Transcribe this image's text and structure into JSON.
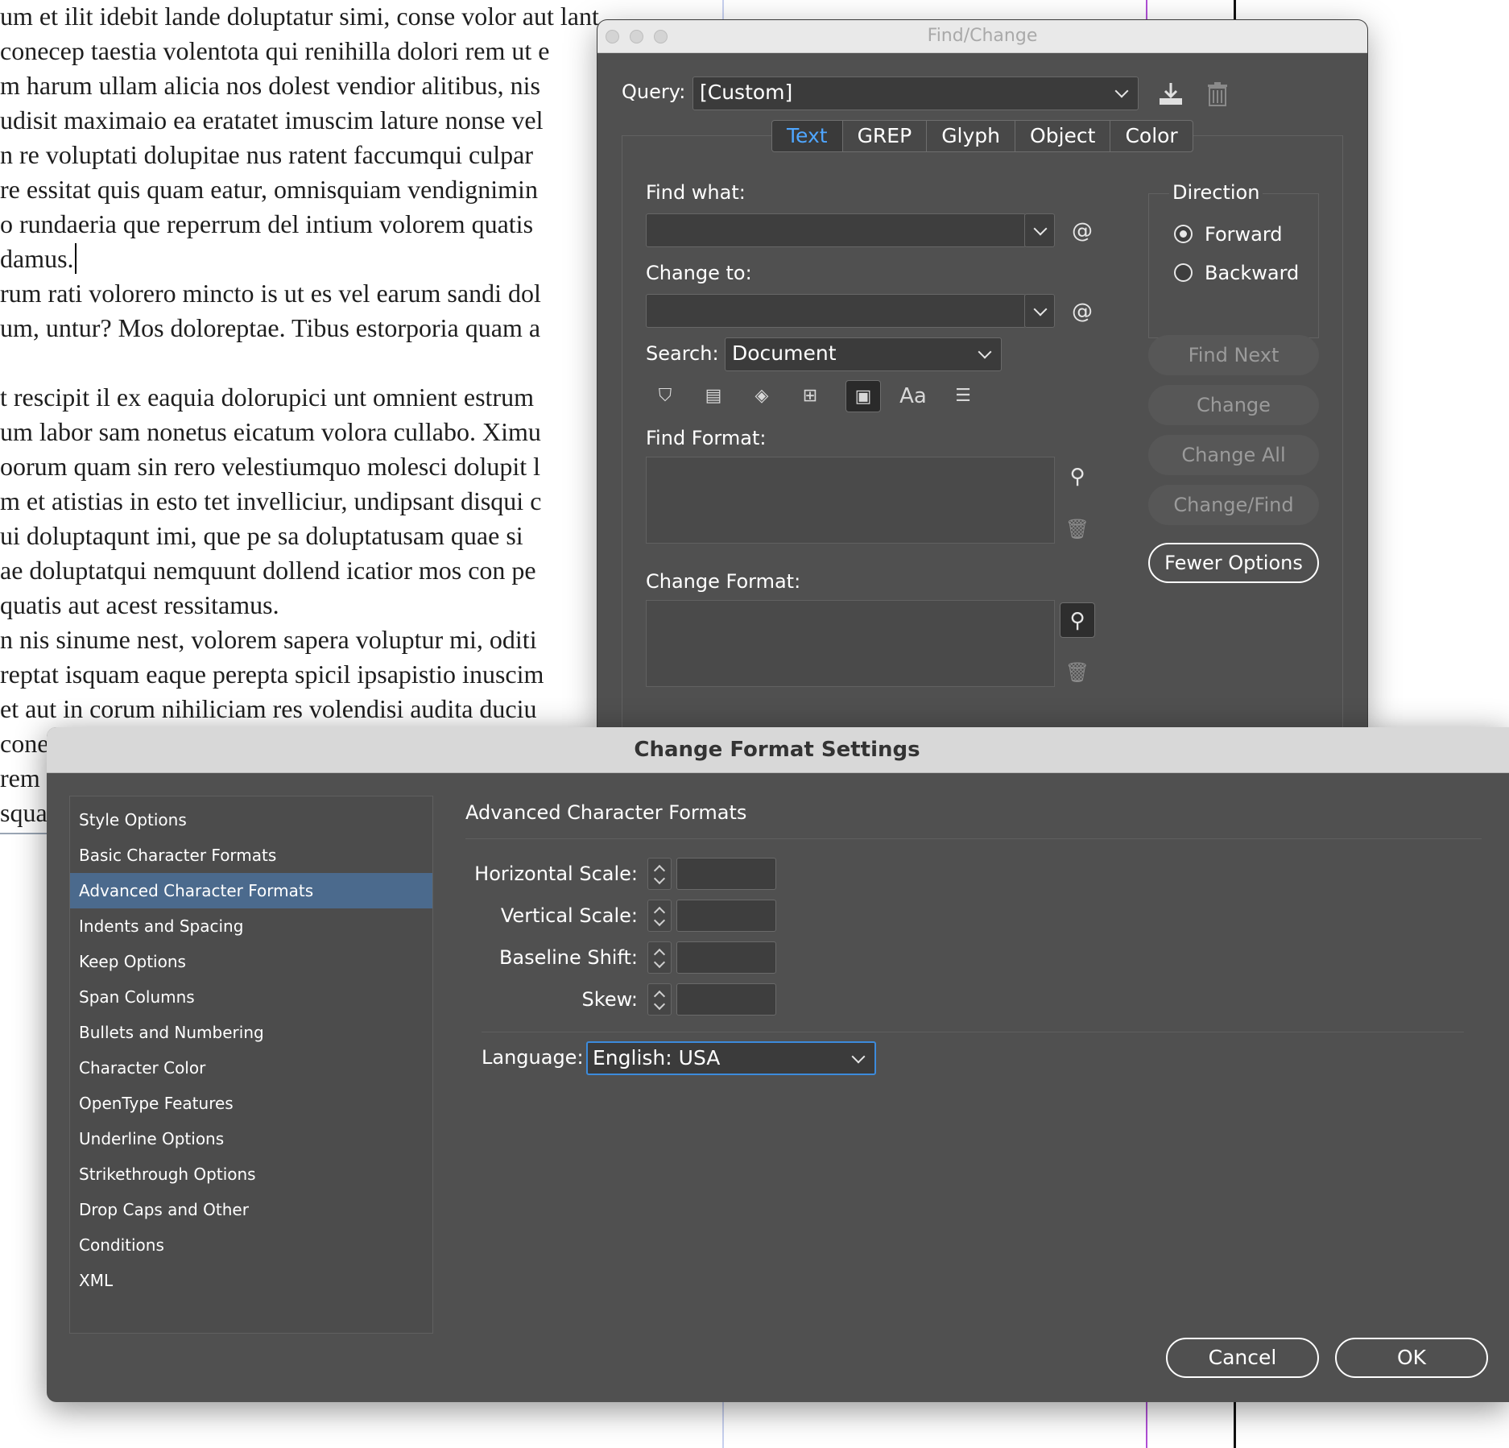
{
  "document": {
    "lines": [
      "um et ilit idebit lande doluptatur simi, conse volor aut lant",
      "conecep taestia volentota qui renihilla dolori rem ut e",
      "m harum ullam alicia nos dolest vendior alitibus, nis",
      "udisit maximaio ea eratatet imuscim lature nonse vel",
      "n re voluptati dolupitae nus ratent faccumqui culpar",
      "re essitat quis quam eatur, omnisquiam vendignimin",
      "o rundaeria que reperrum del intium volorem quatis",
      "damus.",
      "rum rati volorero mincto is ut es vel earum sandi dol",
      "um, untur? Mos doloreptae. Tibus estorporia quam a",
      "",
      "t rescipit il ex eaquia dolorupici unt omnient estrum",
      "um labor sam nonetus eicatum volora cullabo. Ximu",
      "oorum quam sin rero velestiumquo molesci dolupit l",
      "m et atistias in esto tet invelliciur, undipsant disqui c",
      "ui doluptaqunt imi, que pe sa doluptatusam quae si",
      "ae doluptatqui nemquunt dollend icatior mos con pe",
      "quatis aut acest ressitamus.",
      "n nis sinume nest, volorem sapera voluptur mi, oditi",
      "reptat isquam eaque perepta spicil ipsapistio inuscim",
      "et aut in corum nihiliciam res volendisi audita duciu",
      "cone",
      "rem",
      "squa"
    ],
    "guide_colors": {
      "magenta": "#b04fd6",
      "black": "#111111",
      "blue": "#a9b7e6"
    }
  },
  "find_change": {
    "title": "Find/Change",
    "query_label": "Query:",
    "query_value": "[Custom]",
    "save_query_icon": "download-icon",
    "delete_query_icon": "trash-icon",
    "tabs": [
      {
        "label": "Text",
        "active": true
      },
      {
        "label": "GREP",
        "active": false
      },
      {
        "label": "Glyph",
        "active": false
      },
      {
        "label": "Object",
        "active": false
      },
      {
        "label": "Color",
        "active": false
      }
    ],
    "find_what_label": "Find what:",
    "find_what_value": "",
    "change_to_label": "Change to:",
    "change_to_value": "",
    "special_char_glyph": "@",
    "search_label": "Search:",
    "search_value": "Document",
    "option_icons": [
      {
        "name": "include-locked-layers-icon",
        "glyph": "⛉"
      },
      {
        "name": "include-locked-stories-icon",
        "glyph": "▤"
      },
      {
        "name": "include-hidden-layers-icon",
        "glyph": "◈"
      },
      {
        "name": "include-master-pages-icon",
        "glyph": "⊞"
      },
      {
        "name": "include-footnotes-icon",
        "glyph": "▣"
      },
      {
        "name": "case-sensitive-icon",
        "glyph": "Aa"
      },
      {
        "name": "whole-word-icon",
        "glyph": "☰"
      }
    ],
    "find_format_label": "Find Format:",
    "change_format_label": "Change Format:",
    "direction": {
      "legend": "Direction",
      "forward": "Forward",
      "backward": "Backward",
      "selected": "forward"
    },
    "buttons": {
      "find_next": "Find Next",
      "change": "Change",
      "change_all": "Change All",
      "change_find": "Change/Find",
      "fewer_options": "Fewer Options"
    }
  },
  "change_format_settings": {
    "title": "Change Format Settings",
    "categories": [
      "Style Options",
      "Basic Character Formats",
      "Advanced Character Formats",
      "Indents and Spacing",
      "Keep Options",
      "Span Columns",
      "Bullets and Numbering",
      "Character Color",
      "OpenType Features",
      "Underline Options",
      "Strikethrough Options",
      "Drop Caps and Other",
      "Conditions",
      "XML"
    ],
    "selected_category_index": 2,
    "section_title": "Advanced Character Formats",
    "fields": [
      {
        "label": "Horizontal Scale:",
        "value": ""
      },
      {
        "label": "Vertical Scale:",
        "value": ""
      },
      {
        "label": "Baseline Shift:",
        "value": ""
      },
      {
        "label": "Skew:",
        "value": ""
      }
    ],
    "language_label": "Language:",
    "language_value": "English: USA",
    "cancel_label": "Cancel",
    "ok_label": "OK",
    "selection_color": "#4b6a8d",
    "focus_color": "#3c8bdc"
  }
}
